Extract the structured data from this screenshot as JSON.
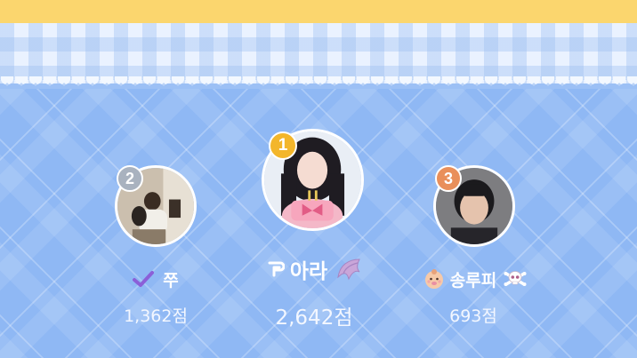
{
  "colors": {
    "top_bar": "#fbd66e",
    "background": "#8fb8f4",
    "gold_badge": "#f3b62b",
    "silver_badge": "#a9b2bf",
    "bronze_badge": "#e98f5a"
  },
  "leaderboard": [
    {
      "rank": "1",
      "name": "아라",
      "prefix_icon": "dripping-letter-icon",
      "suffix_icon": "wing-icon",
      "score": "2,642점"
    },
    {
      "rank": "2",
      "name": "쭈",
      "prefix_icon": "check-icon",
      "suffix_icon": "",
      "score": "1,362점"
    },
    {
      "rank": "3",
      "name": "송루피",
      "prefix_icon": "baby-face-icon",
      "suffix_icon": "skull-crossbones-icon",
      "score": "693점"
    }
  ]
}
